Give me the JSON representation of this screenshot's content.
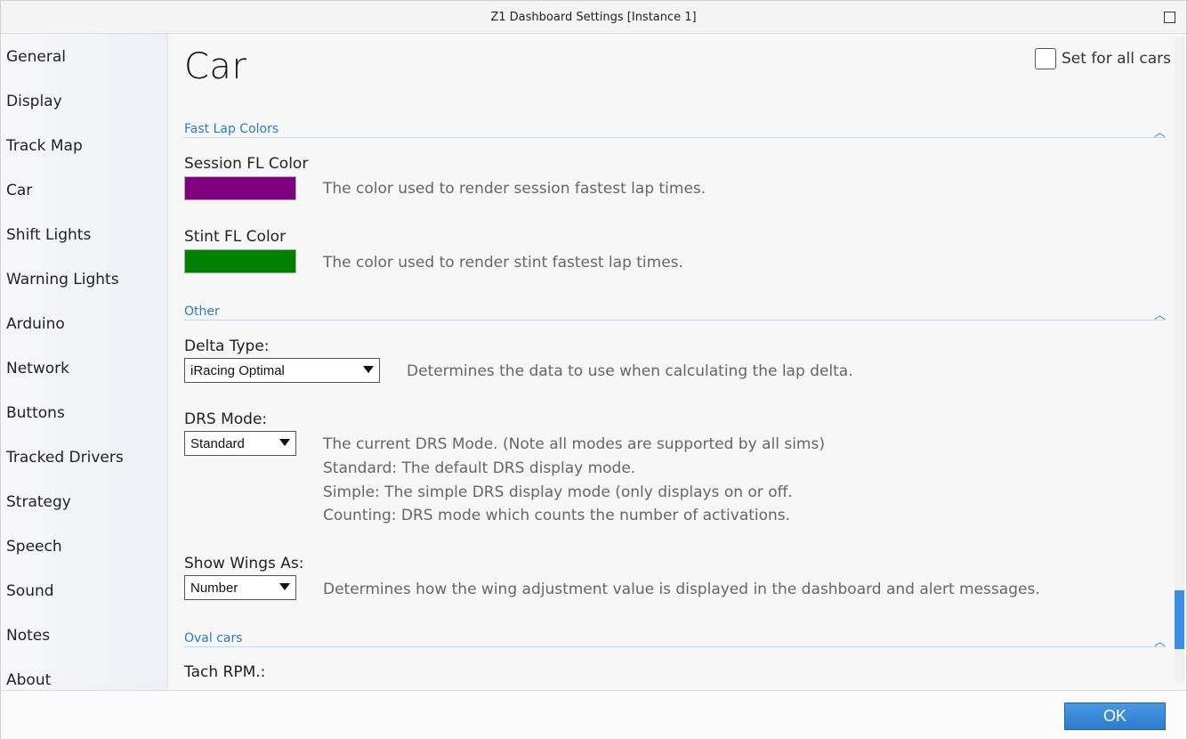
{
  "window": {
    "title": "Z1 Dashboard Settings [Instance 1]"
  },
  "sidebar": {
    "items": [
      {
        "label": "General"
      },
      {
        "label": "Display"
      },
      {
        "label": "Track Map"
      },
      {
        "label": "Car"
      },
      {
        "label": "Shift Lights"
      },
      {
        "label": "Warning Lights"
      },
      {
        "label": "Arduino"
      },
      {
        "label": "Network"
      },
      {
        "label": "Buttons"
      },
      {
        "label": "Tracked Drivers"
      },
      {
        "label": "Strategy"
      },
      {
        "label": "Speech"
      },
      {
        "label": "Sound"
      },
      {
        "label": "Notes"
      },
      {
        "label": "About"
      }
    ]
  },
  "page": {
    "title": "Car",
    "set_all_cars_label": "Set for all cars"
  },
  "sections": {
    "fast_lap_colors": {
      "title": "Fast Lap Colors",
      "session_fl_label": "Session FL Color",
      "session_fl_color": "#800080",
      "session_fl_desc": "The color used to render session fastest lap times.",
      "stint_fl_label": "Stint FL Color",
      "stint_fl_color": "#008000",
      "stint_fl_desc": "The color used to render stint fastest lap times."
    },
    "other": {
      "title": "Other",
      "delta_type_label": "Delta Type:",
      "delta_type_value": "iRacing Optimal",
      "delta_type_desc": "Determines the data to use when calculating the lap delta.",
      "drs_mode_label": "DRS Mode:",
      "drs_mode_value": "Standard",
      "drs_mode_desc_lines": [
        "The current DRS Mode. (Note all modes are supported by all sims)",
        "Standard: The default DRS display mode.",
        "Simple: The simple DRS display mode (only displays on or off.",
        "Counting: DRS mode which counts the number of activations."
      ],
      "show_wings_label": "Show Wings As:",
      "show_wings_value": "Number",
      "show_wings_desc": "Determines how the wing adjustment value is displayed in the dashboard and alert messages."
    },
    "oval_cars": {
      "title": "Oval cars",
      "tach_rpm_label": "Tach RPM.:"
    }
  },
  "footer": {
    "ok_label": "OK"
  },
  "icons": {
    "collapse": "chevron-up-icon",
    "dropdown": "dropdown-arrow-icon",
    "window": "maximize-icon"
  }
}
